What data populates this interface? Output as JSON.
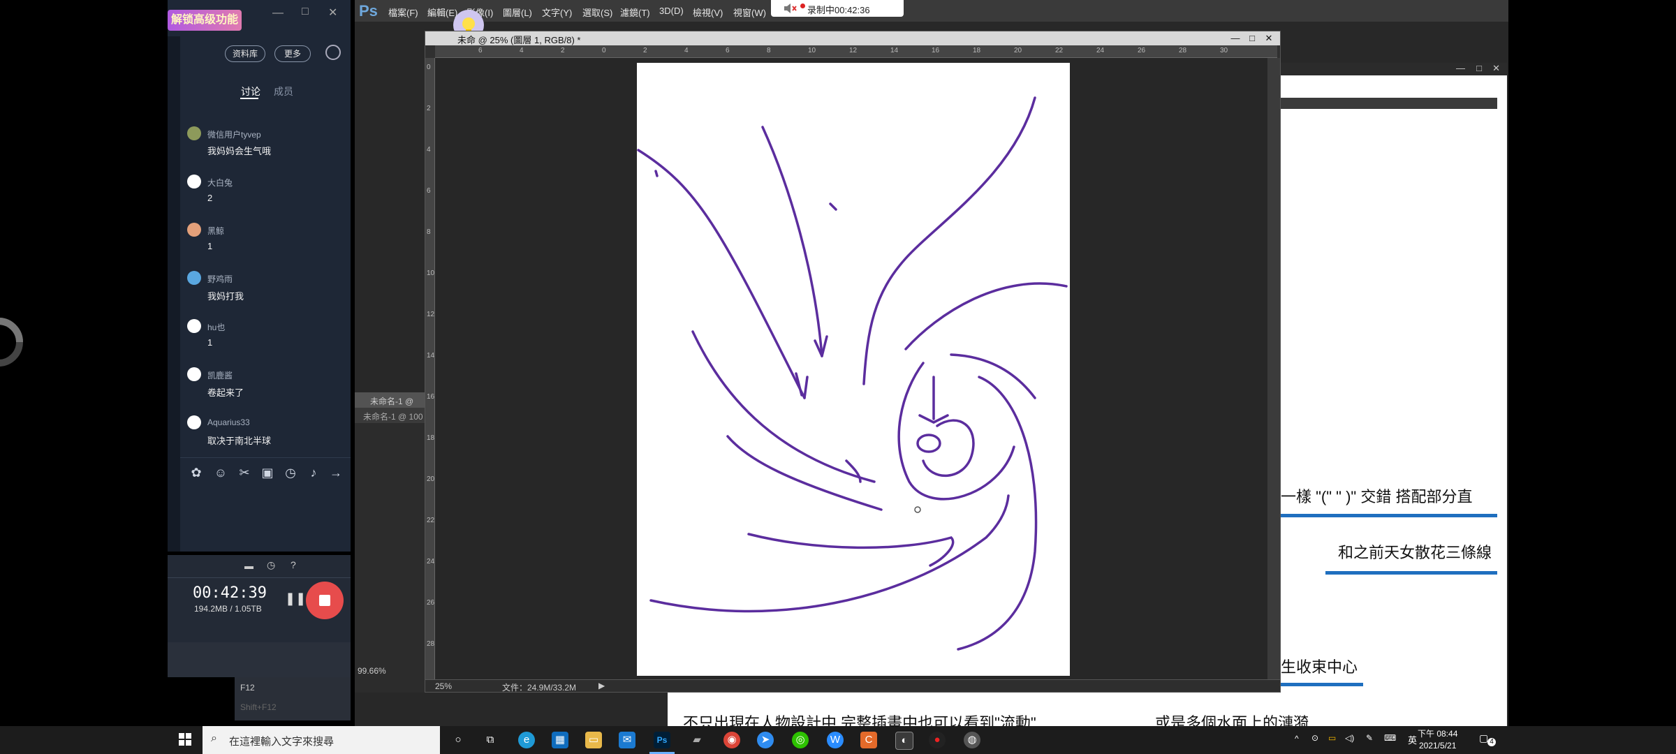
{
  "photoshop": {
    "logo": "Ps",
    "menus": [
      "檔案(F)",
      "編輯(E)",
      "影像(I)",
      "圖層(L)",
      "文字(Y)",
      "選取(S)",
      "濾鏡(T)",
      "3D(D)",
      "檢視(V)",
      "視窗(W)"
    ],
    "recording_label": "录制中00:42:36",
    "doc_title": "未命 @ 25% (圖層 1, RGB/8) *",
    "ruler_top_ticks": [
      "6",
      "4",
      "2",
      "0",
      "2",
      "4",
      "6",
      "8",
      "10",
      "12",
      "14",
      "16",
      "18",
      "20",
      "22",
      "24",
      "26",
      "28",
      "30"
    ],
    "ruler_left_ticks": [
      "0",
      "2",
      "4",
      "6",
      "8",
      "10",
      "12",
      "14",
      "16",
      "18",
      "20",
      "22",
      "24",
      "26",
      "28"
    ],
    "zoom_status": "25%",
    "file_status": "文件：24.9M/33.2M",
    "small_win_title1": "未命名-1 @",
    "small_win_title2": "未命名-1 @ 100",
    "small_win_zoom": "99.66%"
  },
  "back_window": {
    "text1": "一樣 \"(\" \" )\" 交錯 搭配部分直",
    "text2": "和之前天女散花三條線",
    "text3": "生收束中心",
    "text4": "不只出現在人物設計中,完整插畫中也可以看到\"流動\"",
    "text5": "或是多個水面上的漣漪"
  },
  "chat": {
    "vip_label": "解锁高级功能",
    "library_button": "资料库",
    "more_button": "更多",
    "tab_discussion": "讨论",
    "tab_members": "成员",
    "messages": [
      {
        "name": "微信用户tyvep",
        "text": "我妈妈会生气哦"
      },
      {
        "name": "大白兔",
        "text": "2"
      },
      {
        "name": "黑鲸",
        "text": "1"
      },
      {
        "name": "野鸡雨",
        "text": "我妈打我"
      },
      {
        "name": "hu也",
        "text": "1"
      },
      {
        "name": "凯鹿酱",
        "text": "卷起来了"
      },
      {
        "name": "Aquarius33",
        "text": "取决于南北半球"
      }
    ]
  },
  "recorder": {
    "time": "00:42:39",
    "size": "194.2MB / 1.05TB",
    "fkey1": "F12",
    "fkey2": "Shift+F12"
  },
  "taskbar": {
    "search_placeholder": "在這裡輸入文字來搜尋",
    "ime": "英",
    "time": "下午 08:44",
    "date": "2021/5/21",
    "notify_count": "4"
  },
  "colors": {
    "stroke": "#5b2d9e",
    "accent_blue": "#1f6fbf",
    "stop_red": "#e74c4c"
  }
}
